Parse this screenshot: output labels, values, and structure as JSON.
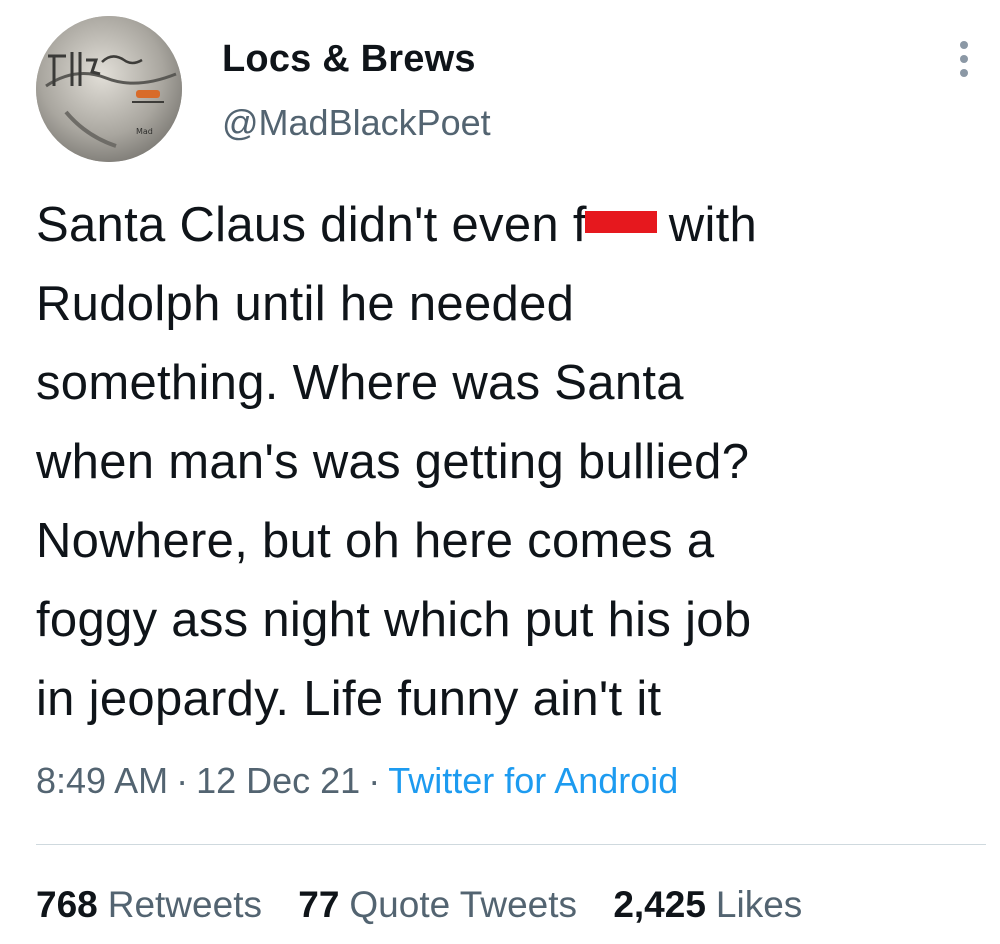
{
  "tweet": {
    "author": {
      "display_name": "Locs & Brews",
      "handle": "@MadBlackPoet",
      "avatar_icon": "avatar-image"
    },
    "text_lines": [
      {
        "before": "Santa Claus didn't even f",
        "after": "with"
      },
      "Rudolph until he needed",
      "something. Where was Santa",
      "when man's was getting bullied?",
      "Nowhere, but oh here comes a",
      "foggy ass night which put his job",
      "in jeopardy. Life funny ain't it"
    ],
    "censor_color": "#e6181e",
    "time": "8:49 AM",
    "date": "12 Dec 21",
    "source": "Twitter for Android",
    "separator": "·",
    "stats": {
      "retweets": {
        "count": "768",
        "label": "Retweets"
      },
      "quote_tweets": {
        "count": "77",
        "label": "Quote Tweets"
      },
      "likes": {
        "count": "2,425",
        "label": "Likes"
      }
    },
    "more_icon": "more-vertical-icon"
  },
  "colors": {
    "text": "#0f1419",
    "secondary": "#536471",
    "link": "#1d9bf0"
  }
}
